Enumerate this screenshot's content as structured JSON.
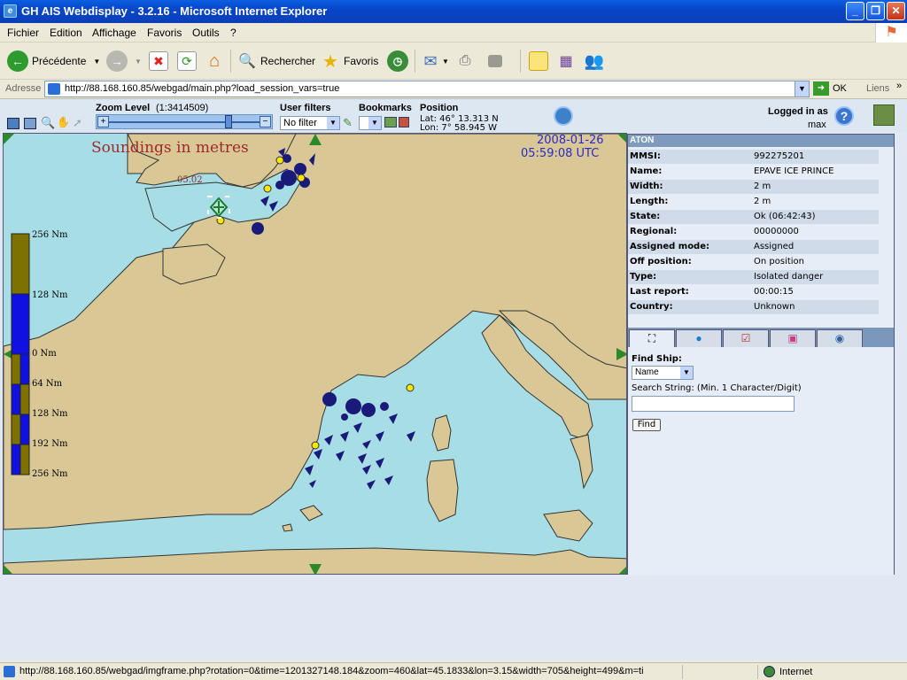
{
  "window": {
    "title": "GH AIS Webdisplay - 3.2.16 - Microsoft Internet Explorer"
  },
  "menu": [
    "Fichier",
    "Edition",
    "Affichage",
    "Favoris",
    "Outils",
    "?"
  ],
  "toolbar": {
    "back": "Précédente",
    "search": "Rechercher",
    "favorites": "Favoris"
  },
  "address": {
    "label": "Adresse",
    "url": "http://88.168.160.85/webgad/main.php?load_session_vars=true",
    "go": "OK",
    "links": "Liens"
  },
  "app": {
    "zoom_label": "Zoom Level",
    "zoom_scale": "(1:3414509)",
    "user_filters_label": "User filters",
    "filter_value": "No filter",
    "bookmarks_label": "Bookmarks",
    "position_label": "Position",
    "lat": "Lat: 46° 13.313 N",
    "lon": "Lon: 7° 58.945 W",
    "logged_in_label": "Logged in as",
    "user": "max",
    "help": "?"
  },
  "map": {
    "soundings_label": "Soundings in metres",
    "date": "2008-01-26",
    "time": "05:59:08 UTC",
    "sounding_value": "05.02",
    "scale_labels": [
      "256 Nm",
      "128 Nm",
      "0 Nm",
      "64 Nm",
      "128 Nm",
      "192 Nm",
      "256 Nm"
    ],
    "colors": {
      "sea": "#a7dde5",
      "land": "#d9c796",
      "ship": "#1a1a7a",
      "aton": "#ffe600"
    }
  },
  "panel": {
    "header": "ATON",
    "rows": [
      {
        "k": "MMSI:",
        "v": "992275201"
      },
      {
        "k": "Name:",
        "v": "EPAVE ICE PRINCE"
      },
      {
        "k": "Width:",
        "v": "2 m"
      },
      {
        "k": "Length:",
        "v": "2 m"
      },
      {
        "k": "State:",
        "v": "Ok (06:42:43)"
      },
      {
        "k": "Regional:",
        "v": "00000000"
      },
      {
        "k": "Assigned mode:",
        "v": "Assigned"
      },
      {
        "k": "Off position:",
        "v": "On position"
      },
      {
        "k": "Type:",
        "v": "Isolated danger"
      },
      {
        "k": "Last report:",
        "v": "00:00:15"
      },
      {
        "k": "Country:",
        "v": "Unknown"
      }
    ],
    "find_ship_label": "Find Ship:",
    "find_by": "Name",
    "search_hint": "Search String: (Min. 1 Character/Digit)",
    "search_value": "",
    "find_button": "Find"
  },
  "status": {
    "url": "http://88.168.160.85/webgad/imgframe.php?rotation=0&time=1201327148.184&zoom=460&lat=45.1833&lon=3.15&width=705&height=499&m=ti",
    "zone": "Internet"
  }
}
